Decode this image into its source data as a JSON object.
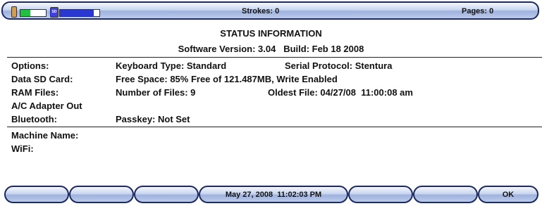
{
  "top_bar": {
    "strokes": "Strokes: 0",
    "pages": "Pages: 0"
  },
  "indicators": {
    "battery_level": 0.4,
    "storage_level": 0.85,
    "sd_label": "SD"
  },
  "colors": {
    "battery_fill": "#22c040",
    "storage_fill": "#2838d0",
    "border": "#1d2a60"
  },
  "status": {
    "title": "STATUS INFORMATION",
    "version": "Software Version: 3.04   Build: Feb 18 2008"
  },
  "rows": {
    "options_label": "Options:",
    "keyboard_type": "Keyboard Type: Standard",
    "serial_protocol": "Serial Protocol: Stentura",
    "sd_label": "Data SD Card:",
    "sd_value": "Free Space: 85% Free of 121.487MB, Write Enabled",
    "ram_label": "RAM Files:",
    "num_files": "Number of Files: 9",
    "oldest_file": "Oldest File: 04/27/08  11:00:08 am",
    "adapter": "A/C Adapter Out",
    "bluetooth_label": "Bluetooth:",
    "passkey": "Passkey: Not Set",
    "machine_name_label": "Machine Name:",
    "wifi_label": "WiFi:"
  },
  "bottom_bar": {
    "datetime": "May 27, 2008  11:02:03 PM",
    "ok": "OK"
  }
}
